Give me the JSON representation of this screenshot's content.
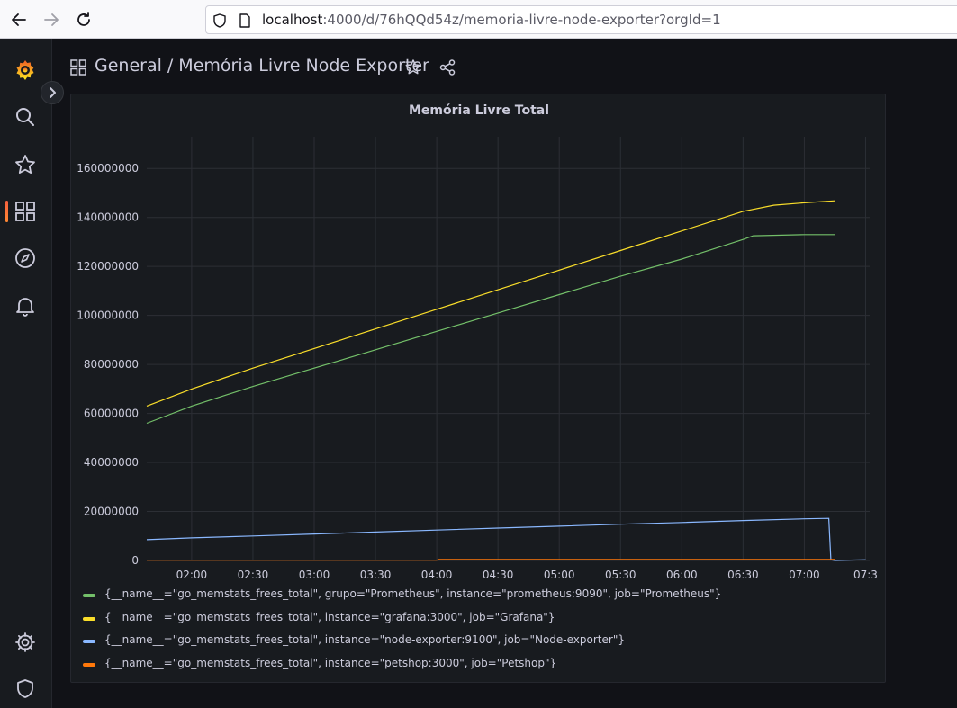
{
  "browser": {
    "url_host": "localhost",
    "url_rest": ":4000/d/76hQQd54z/memoria-livre-node-exporter?orgId=1"
  },
  "header": {
    "folder": "General",
    "separator": "/",
    "dashboard_title": "Memória Livre Node Exporter"
  },
  "panel": {
    "title": "Memória Livre Total"
  },
  "colors": {
    "green": "#73bf69",
    "yellow": "#fade2a",
    "blue": "#8ab8ff",
    "orange": "#ff780a",
    "grafana_brand": "#f46800"
  },
  "sidebar": {
    "items": [
      "grafana-logo-icon",
      "search-icon",
      "star-icon",
      "dashboards-icon",
      "explore-icon",
      "alerting-icon",
      "settings-icon",
      "shield-icon"
    ],
    "active": "dashboards-icon"
  },
  "chart_data": {
    "type": "line",
    "title": "Memória Livre Total",
    "xlabel": "",
    "ylabel": "",
    "x_ticks": [
      "02:00",
      "02:30",
      "03:00",
      "03:30",
      "04:00",
      "04:30",
      "05:00",
      "05:30",
      "06:00",
      "06:30",
      "07:00",
      "07:3"
    ],
    "y_ticks": [
      "0",
      "20000000",
      "40000000",
      "60000000",
      "80000000",
      "100000000",
      "120000000",
      "140000000",
      "160000000"
    ],
    "ylim": [
      0,
      170000000
    ],
    "xlim": [
      "01:38",
      "07:30"
    ],
    "grid": true,
    "legend_position": "bottom",
    "series": [
      {
        "name": "{__name__=\"go_memstats_frees_total\", grupo=\"Prometheus\", instance=\"prometheus:9090\", job=\"Prometheus\"}",
        "color": "#73bf69",
        "x": [
          "01:38",
          "02:00",
          "02:30",
          "03:00",
          "03:30",
          "04:00",
          "04:30",
          "05:00",
          "05:30",
          "06:00",
          "06:30",
          "06:35",
          "07:00",
          "07:15"
        ],
        "values": [
          56000000,
          63000000,
          71000000,
          78500000,
          86000000,
          93500000,
          101000000,
          108500000,
          116000000,
          123000000,
          131000000,
          132500000,
          133000000,
          133000000
        ]
      },
      {
        "name": "{__name__=\"go_memstats_frees_total\", instance=\"grafana:3000\", job=\"Grafana\"}",
        "color": "#fade2a",
        "x": [
          "01:38",
          "02:00",
          "02:30",
          "03:00",
          "03:30",
          "04:00",
          "04:30",
          "05:00",
          "05:30",
          "06:00",
          "06:30",
          "06:45",
          "07:00",
          "07:15"
        ],
        "values": [
          63000000,
          70000000,
          78500000,
          86500000,
          94500000,
          102500000,
          110500000,
          118500000,
          126500000,
          134500000,
          142500000,
          145000000,
          146000000,
          146800000
        ]
      },
      {
        "name": "{__name__=\"go_memstats_frees_total\", instance=\"node-exporter:9100\", job=\"Node-exporter\"}",
        "color": "#8ab8ff",
        "x": [
          "01:38",
          "02:00",
          "02:30",
          "03:00",
          "03:30",
          "04:00",
          "04:30",
          "05:00",
          "05:30",
          "06:00",
          "06:30",
          "07:00",
          "07:12",
          "07:13",
          "07:15",
          "07:30"
        ],
        "values": [
          8500000,
          9200000,
          10000000,
          10800000,
          11600000,
          12400000,
          13200000,
          14000000,
          14800000,
          15500000,
          16300000,
          17000000,
          17200000,
          300000,
          0,
          300000
        ]
      },
      {
        "name": "{__name__=\"go_memstats_frees_total\", instance=\"petshop:3000\", job=\"Petshop\"}",
        "color": "#ff780a",
        "x": [
          "01:38",
          "04:00",
          "04:01",
          "07:15"
        ],
        "values": [
          100000,
          100000,
          400000,
          400000
        ]
      }
    ]
  }
}
